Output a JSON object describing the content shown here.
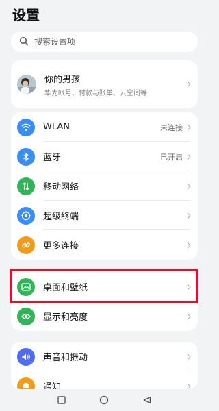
{
  "header": {
    "title": "设置"
  },
  "search": {
    "placeholder": "搜索设置项"
  },
  "profile": {
    "name": "你的男孩",
    "subtitle": "华为帐号、付款与账单、云空间等"
  },
  "group1": [
    {
      "label": "WLAN",
      "value": "未连接",
      "icon": "wifi-icon",
      "color": "#3a8ef0"
    },
    {
      "label": "蓝牙",
      "value": "已开启",
      "icon": "bluetooth-icon",
      "color": "#3a8ef0"
    },
    {
      "label": "移动网络",
      "value": "",
      "icon": "mobile-network-icon",
      "color": "#33b35a"
    },
    {
      "label": "超级终端",
      "value": "",
      "icon": "super-device-icon",
      "color": "#3a8ef0"
    },
    {
      "label": "更多连接",
      "value": "",
      "icon": "link-icon",
      "color": "#f29a1c"
    }
  ],
  "group2": [
    {
      "label": "桌面和壁纸",
      "icon": "wallpaper-icon",
      "color": "#33b35a"
    },
    {
      "label": "显示和亮度",
      "icon": "eye-icon",
      "color": "#33b35a"
    }
  ],
  "group3": [
    {
      "label": "声音和振动",
      "icon": "sound-icon",
      "color": "#4f6cf0"
    },
    {
      "label": "通知",
      "icon": "notification-icon",
      "color": "#f29a1c"
    }
  ],
  "highlight_color": "#e0112c",
  "navbar": {
    "buttons": [
      "back-icon",
      "home-icon",
      "recents-icon"
    ]
  }
}
